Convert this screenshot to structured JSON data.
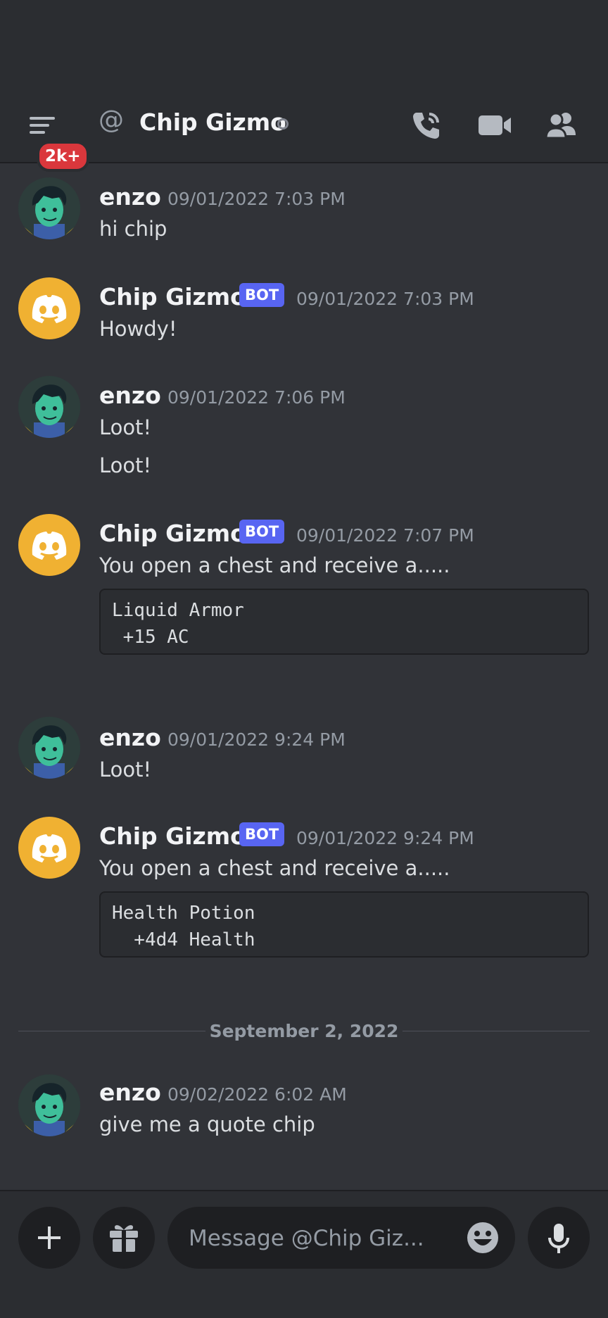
{
  "header": {
    "badge": "2k+",
    "at_symbol": "@",
    "title": "Chip Gizmo"
  },
  "messages": [
    {
      "author": "enzo",
      "timestamp": "09/01/2022 7:03 PM",
      "lines": [
        "hi chip"
      ]
    },
    {
      "author": "Chip Gizmo",
      "tag": "BOT",
      "timestamp": "09/01/2022 7:03 PM",
      "lines": [
        "Howdy!"
      ]
    },
    {
      "author": "enzo",
      "timestamp": "09/01/2022 7:06 PM",
      "lines": [
        "Loot!",
        "Loot!"
      ]
    },
    {
      "author": "Chip Gizmo",
      "tag": "BOT",
      "timestamp": "09/01/2022 7:07 PM",
      "lines": [
        "You open a chest and receive a....."
      ],
      "code": "Liquid Armor\n +15 AC"
    },
    {
      "author": "enzo",
      "timestamp": "09/01/2022 9:24 PM",
      "lines": [
        "Loot!"
      ]
    },
    {
      "author": "Chip Gizmo",
      "tag": "BOT",
      "timestamp": "09/01/2022 9:24 PM",
      "lines": [
        "You open a chest and receive a....."
      ],
      "code": "Health Potion\n  +4d4 Health"
    },
    {
      "author": "enzo",
      "timestamp": "09/02/2022 6:02 AM",
      "lines": [
        "give me a quote chip"
      ]
    }
  ],
  "date_divider": "September 2, 2022",
  "composer": {
    "placeholder": "Message @Chip Giz..."
  },
  "colors": {
    "background": "#313338",
    "header": "#2b2d31",
    "blurple": "#5865f2",
    "bot_avatar": "#f0b132",
    "badge_red": "#da373c"
  },
  "icons": [
    "menu-icon",
    "at-icon",
    "call-icon",
    "video-icon",
    "members-icon",
    "plus-icon",
    "gift-icon",
    "emoji-icon",
    "microphone-icon"
  ]
}
